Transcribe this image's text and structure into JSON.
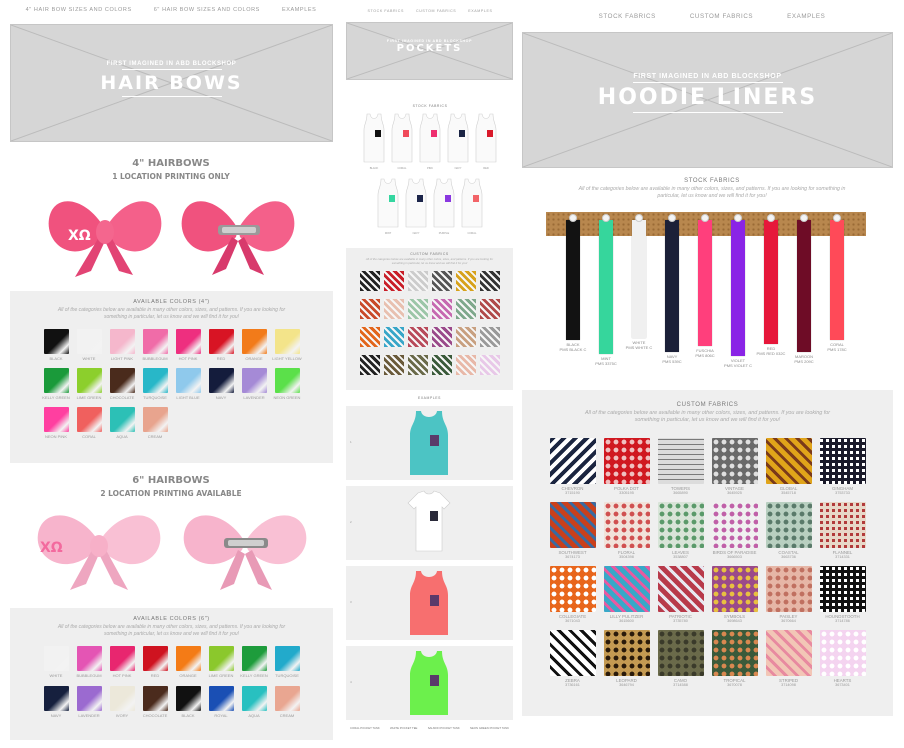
{
  "left": {
    "nav": [
      "4\" HAIR BOW SIZES AND COLORS",
      "6\" HAIR BOW SIZES AND COLORS",
      "EXAMPLES"
    ],
    "hero": {
      "kicker": "FIRST IMAGINED IN ABD BLOCKSHOP",
      "title": "HAIR BOWS"
    },
    "bow4": {
      "title": "4\" HAIRBOWS",
      "subtitle": "1 LOCATION PRINTING ONLY",
      "monogram": "ΧΩ"
    },
    "colors4": {
      "title": "AVAILABLE COLORS (4\")",
      "desc": "All of the categories below are available in many other colors, sizes, and patterns. If you are looking for something in particular, let us know and we will find it for you!",
      "items": [
        {
          "label": "BLACK",
          "color": "#111111"
        },
        {
          "label": "WHITE",
          "color": "#f2f2f2"
        },
        {
          "label": "LIGHT PINK",
          "color": "#f5b7cc"
        },
        {
          "label": "BUBBLEGUM",
          "color": "#f06ca8"
        },
        {
          "label": "HOT PINK",
          "color": "#ee2f7f"
        },
        {
          "label": "RED",
          "color": "#d81424"
        },
        {
          "label": "ORANGE",
          "color": "#f27b1a"
        },
        {
          "label": "LIGHT YELLOW",
          "color": "#f3e48a"
        },
        {
          "label": "KELLY GREEN",
          "color": "#1a9a3a"
        },
        {
          "label": "LIME GREEN",
          "color": "#8ccf2c"
        },
        {
          "label": "CHOCOLATE",
          "color": "#4a2b1c"
        },
        {
          "label": "TURQUOISE",
          "color": "#28b7c8"
        },
        {
          "label": "LIGHT BLUE",
          "color": "#8fc9ec"
        },
        {
          "label": "NAVY",
          "color": "#141c3c"
        },
        {
          "label": "LAVENDER",
          "color": "#a58ad6"
        },
        {
          "label": "NEON GREEN",
          "color": "#5be04a"
        },
        {
          "label": "NEON PINK",
          "color": "#ff3fa0"
        },
        {
          "label": "CORAL",
          "color": "#f0605e"
        },
        {
          "label": "AQUA",
          "color": "#2cc0b6"
        },
        {
          "label": "CREAM",
          "color": "#e8a48e"
        }
      ]
    },
    "bow6": {
      "title": "6\" HAIRBOWS",
      "subtitle": "2 LOCATION PRINTING AVAILABLE",
      "monogram": "ΧΩ"
    },
    "colors6": {
      "title": "AVAILABLE COLORS (6\")",
      "desc": "All of the categories below are available in many other colors, sizes, and patterns. If you are looking for something in particular, let us know and we will find it for you!",
      "items": [
        {
          "label": "WHITE",
          "color": "#f2f2f2"
        },
        {
          "label": "BUBBLEGUM",
          "color": "#e455b4"
        },
        {
          "label": "HOT PINK",
          "color": "#e8266f"
        },
        {
          "label": "RED",
          "color": "#cf1320"
        },
        {
          "label": "ORANGE",
          "color": "#f47b16"
        },
        {
          "label": "LIME GREEN",
          "color": "#8bc82c"
        },
        {
          "label": "KELLY GREEN",
          "color": "#1e9c3c"
        },
        {
          "label": "TURQUOISE",
          "color": "#22aacb"
        },
        {
          "label": "NAVY",
          "color": "#16203e"
        },
        {
          "label": "LAVENDER",
          "color": "#9b6ad0"
        },
        {
          "label": "IVORY",
          "color": "#ece8da"
        },
        {
          "label": "CHOCOLATE",
          "color": "#4b2b1d"
        },
        {
          "label": "BLACK",
          "color": "#111111"
        },
        {
          "label": "ROYAL",
          "color": "#1a4fb4"
        },
        {
          "label": "AQUA",
          "color": "#28c0c0"
        },
        {
          "label": "CREAM",
          "color": "#e9a691"
        }
      ]
    }
  },
  "middle": {
    "nav": [
      "STOCK FABRICS",
      "CUSTOM FABRICS",
      "EXAMPLES"
    ],
    "hero": {
      "kicker": "FIRST IMAGINED IN ABD BLOCKSHOP",
      "title": "POCKETS"
    },
    "stock": {
      "title": "STOCK FABRICS",
      "items": [
        {
          "label": "BLACK",
          "color": "#111"
        },
        {
          "label": "CORAL",
          "color": "#f04a5a"
        },
        {
          "label": "PINK",
          "color": "#ee2f6f"
        },
        {
          "label": "NAVY",
          "color": "#1a2444"
        },
        {
          "label": "RED",
          "color": "#d9192a"
        },
        {
          "label": "MINT",
          "color": "#35d6a0"
        },
        {
          "label": "NAVY",
          "color": "#1c254a"
        },
        {
          "label": "PURPLE",
          "color": "#8a38e0"
        },
        {
          "label": "CORAL",
          "color": "#f26468"
        }
      ]
    },
    "custom": {
      "title": "CUSTOM FABRICS",
      "desc": "All of the categories below are available in many other colors, sizes, and patterns. If you are looking for something in particular, let us know and we will find it for you!",
      "colors": [
        "#222",
        "#c81e28",
        "#ccc",
        "#555",
        "#d7a21c",
        "#333",
        "#c94a2a",
        "#e8c0b0",
        "#9cc6a8",
        "#c66ab0",
        "#7fa88c",
        "#b04a4a",
        "#e2661c",
        "#38a6c8",
        "#b84a5a",
        "#9a4a8a",
        "#c8a080",
        "#9a9a9a",
        "#222",
        "#6a5a3a",
        "#6a6a4a",
        "#3a5a3a",
        "#e8b8a8",
        "#e8c8e8"
      ]
    },
    "examples": {
      "title": "EXAMPLES",
      "items": [
        {
          "num": "1",
          "shirt": "#4cc4c4"
        },
        {
          "num": "2",
          "shirt": "#ffffff"
        },
        {
          "num": "3",
          "shirt": "#f76f6f"
        },
        {
          "num": "4",
          "shirt": "#6cf04c"
        }
      ],
      "captions": [
        "CORAL POCKET TANK",
        "WHITE POCKET TEE",
        "SALMON POCKET TANK",
        "NEON GREEN POCKET TANK"
      ]
    }
  },
  "right": {
    "nav": [
      "STOCK FABRICS",
      "CUSTOM FABRICS",
      "EXAMPLES"
    ],
    "hero": {
      "kicker": "FIRST IMAGINED IN ABD BLOCKSHOP",
      "title": "HOODIE LINERS"
    },
    "stock": {
      "title": "STOCK FABRICS",
      "desc": "All of the categories below are available in many other colors, sizes, and patterns. If you are looking for something in particular, let us know and we will find it for you!",
      "items": [
        {
          "label": "BLACK\nPMS BLACK C",
          "color": "#121212"
        },
        {
          "label": "MINT\nPMS 3375C",
          "color": "#36d69c"
        },
        {
          "label": "WHITE\nPMS WHITE C",
          "color": "#f0f0f0"
        },
        {
          "label": "NAVY\nPMS 539C",
          "color": "#1b2038"
        },
        {
          "label": "FUSCHIA\nPMS 806C",
          "color": "#ff3f7c"
        },
        {
          "label": "VIOLET\nPMS VIOLET C",
          "color": "#8a24e6"
        },
        {
          "label": "RED\nPMS RED 032C",
          "color": "#e6173a"
        },
        {
          "label": "MAROON\nPMS 209C",
          "color": "#6e0c26"
        },
        {
          "label": "CORAL\nPMS 178C",
          "color": "#ff4a58"
        }
      ]
    },
    "custom": {
      "title": "CUSTOM FABRICS",
      "desc": "All of the categories below are available in many other colors, sizes, and patterns. If you are looking for something in particular, let us know and we will find it for you!",
      "items": [
        {
          "label": "CHEVRON",
          "code": "3715190",
          "c1": "#1b2540",
          "c2": "#ffffff",
          "p": "chev"
        },
        {
          "label": "POLKA DOT",
          "code": "3305195",
          "c1": "#d01820",
          "c2": "#f0c0c0",
          "p": "dot"
        },
        {
          "label": "TOWERS",
          "code": "3665890",
          "c1": "#dcdcdc",
          "c2": "#7a7a7a",
          "p": "grid"
        },
        {
          "label": "VINTAGE",
          "code": "3645925",
          "c1": "#6a6a6a",
          "c2": "#e0e0e0",
          "p": "dot"
        },
        {
          "label": "GLOBAL",
          "code": "3545718",
          "c1": "#e0a41a",
          "c2": "#7a3a1a",
          "p": "stripe"
        },
        {
          "label": "GINGHAM",
          "code": "3753733",
          "c1": "#ffffff",
          "c2": "#1a1a2a",
          "p": "check"
        },
        {
          "label": "SOUTHWEST",
          "code": "3674173",
          "c1": "#c9401c",
          "c2": "#3a6aa0",
          "p": "stripe"
        },
        {
          "label": "FLORAL",
          "code": "3504398",
          "c1": "#f1e2da",
          "c2": "#d05050",
          "p": "dot"
        },
        {
          "label": "LEAVES",
          "code": "3538807",
          "c1": "#d8e4d8",
          "c2": "#5a9a6a",
          "p": "dot"
        },
        {
          "label": "BIRDS OF PARADISE",
          "code": "3666503",
          "c1": "#f0f0f0",
          "c2": "#c060a8",
          "p": "dot"
        },
        {
          "label": "COASTAL",
          "code": "3663736",
          "c1": "#b8cfc0",
          "c2": "#5a7a6a",
          "p": "dot"
        },
        {
          "label": "FLANNEL",
          "code": "3714331",
          "c1": "#b23a3a",
          "c2": "#e8d8c8",
          "p": "check"
        },
        {
          "label": "COLLEGIATE",
          "code": "3671043",
          "c1": "#e8661c",
          "c2": "#ffffff",
          "p": "dot"
        },
        {
          "label": "LILLY PULITZER",
          "code": "3615600",
          "c1": "#38a8c8",
          "c2": "#e85aa0",
          "p": "stripe"
        },
        {
          "label": "PATRIOTIC",
          "code": "3735780",
          "c1": "#b83a4a",
          "c2": "#e8e8f0",
          "p": "stripe"
        },
        {
          "label": "SYMBOLS",
          "code": "3698643",
          "c1": "#9a4a8a",
          "c2": "#e8c040",
          "p": "dot"
        },
        {
          "label": "PAISLEY",
          "code": "3670664",
          "c1": "#e6b6a6",
          "c2": "#c07060",
          "p": "dot"
        },
        {
          "label": "HOUNDSTOOTH",
          "code": "3714786",
          "c1": "#ffffff",
          "c2": "#111111",
          "p": "check"
        },
        {
          "label": "ZEBRA",
          "code": "3736161",
          "c1": "#ffffff",
          "c2": "#111111",
          "p": "stripe"
        },
        {
          "label": "LEOPARD",
          "code": "3646794",
          "c1": "#c49a52",
          "c2": "#2a1a0a",
          "p": "dot"
        },
        {
          "label": "CAMO",
          "code": "3714588",
          "c1": "#6a6a4a",
          "c2": "#3a3a2a",
          "p": "dot"
        },
        {
          "label": "TROPICAL",
          "code": "3670078",
          "c1": "#3a5a3a",
          "c2": "#d88850",
          "p": "dot"
        },
        {
          "label": "STRIPED",
          "code": "3714098",
          "c1": "#f2c6b6",
          "c2": "#e88aa0",
          "p": "stripe"
        },
        {
          "label": "HEARTS",
          "code": "3673401",
          "c1": "#f4d4f0",
          "c2": "#ffffff",
          "p": "dot"
        }
      ]
    }
  }
}
